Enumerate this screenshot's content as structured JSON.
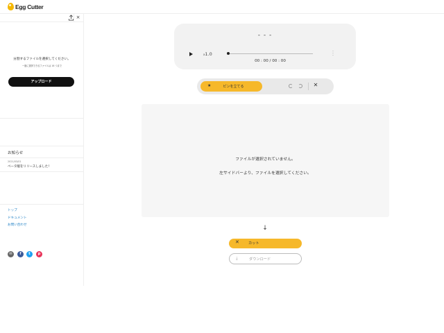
{
  "app": {
    "logo_text": "Egg Cutter"
  },
  "sidebar": {
    "select_prompt": "分割するファイルを選択してください。",
    "select_note": "一度に選択できるファイルは 16 つまで",
    "upload_label": "アップロード",
    "close_glyph": "×",
    "notice": {
      "title": "お知らせ",
      "date": "2021/03/01",
      "text": "ベータ版をリリースしました！"
    },
    "links": [
      "トップ",
      "ドキュメント",
      "お問い合わせ"
    ],
    "social": [
      "email-icon",
      "facebook-icon",
      "twitter-icon",
      "pocket-icon"
    ]
  },
  "player": {
    "title": "- - -",
    "speed_prefix": "x",
    "speed_value": "1.0",
    "time": "00 : 00 / 00 : 00",
    "progress": 0
  },
  "pinbar": {
    "pin_label": "ピンを立てる",
    "star_glyph": "★",
    "close_glyph": "✕"
  },
  "preview": {
    "line1": "ファイルが選択されていません。",
    "line2": "左サイドバーより、ファイルを選択してください。"
  },
  "actions": {
    "arrow_glyph": "↓",
    "cut_label": "カット",
    "cut_glyph": "✕",
    "download_label": "ダウンロード",
    "download_glyph": "⤓"
  },
  "colors": {
    "accent": "#f6b82a",
    "link": "#1a7dc4",
    "dark": "#111111"
  }
}
